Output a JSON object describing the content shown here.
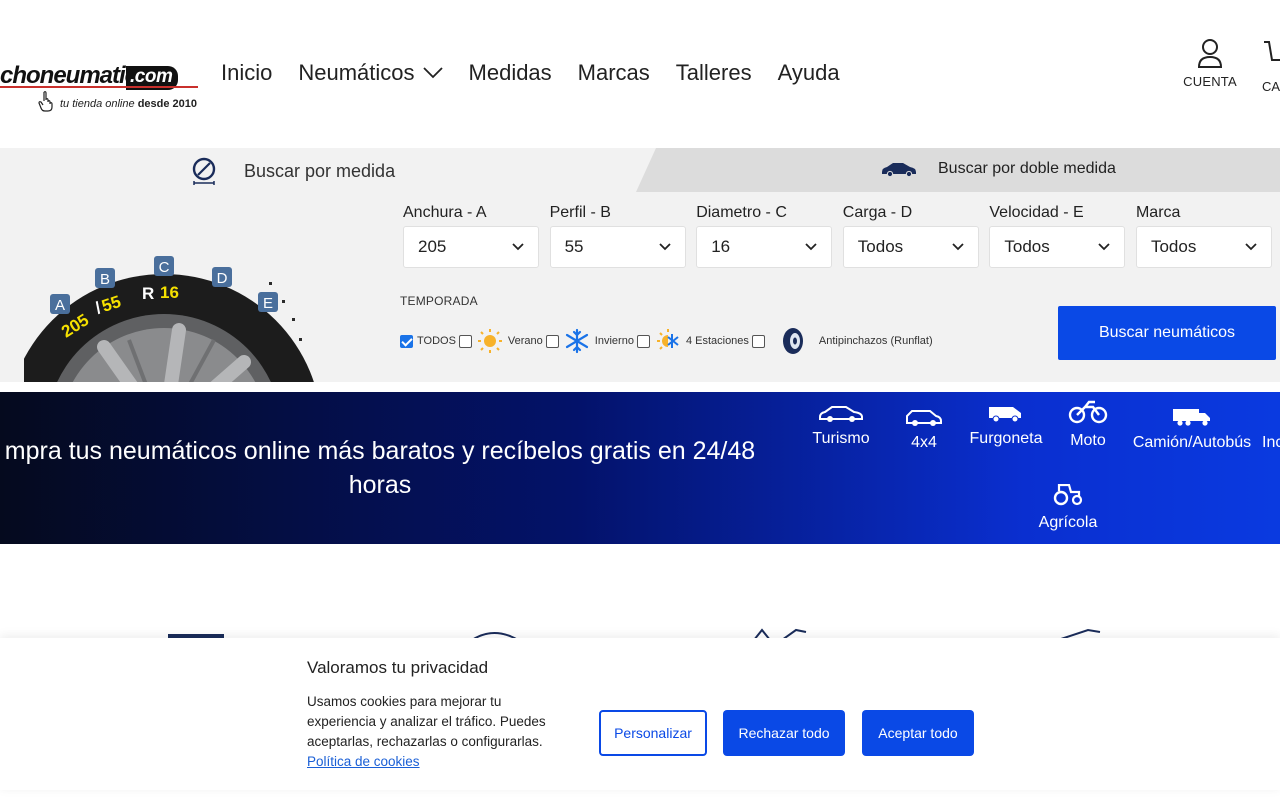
{
  "header": {
    "logo_text": "choneumatico",
    "logo_dotcom": ".com",
    "logo_tagline": "tu tienda online",
    "logo_tagline_bold": "desde 2010",
    "nav": [
      {
        "label": "Inicio"
      },
      {
        "label": "Neumáticos",
        "has_dropdown": true
      },
      {
        "label": "Medidas"
      },
      {
        "label": "Marcas"
      },
      {
        "label": "Talleres"
      },
      {
        "label": "Ayuda"
      }
    ],
    "account_label": "CUENTA",
    "cart_label": "CA"
  },
  "search": {
    "tab_medida": "Buscar por medida",
    "tab_doble": "Buscar por doble medida",
    "fields": [
      {
        "label": "Anchura - A",
        "value": "205"
      },
      {
        "label": "Perfil - B",
        "value": "55"
      },
      {
        "label": "Diametro - C",
        "value": "16"
      },
      {
        "label": "Carga - D",
        "value": "Todos"
      },
      {
        "label": "Velocidad - E",
        "value": "Todos"
      },
      {
        "label": "Marca",
        "value": "Todos"
      }
    ],
    "temporada_label": "TEMPORADA",
    "seasons": [
      {
        "label": "TODOS",
        "checked": true
      },
      {
        "label": "Verano",
        "checked": false,
        "icon": "sun-icon"
      },
      {
        "label": "Invierno",
        "checked": false,
        "icon": "snowflake-icon"
      },
      {
        "label": "4 Estaciones",
        "checked": false,
        "icon": "sun-snow-icon"
      },
      {
        "label": "Antipinchazos (Runflat)",
        "checked": false,
        "icon": "runflat-tire-icon"
      }
    ],
    "button_label": "Buscar neumáticos",
    "tire_diagram": {
      "markers": [
        "A",
        "B",
        "C",
        "D",
        "E"
      ],
      "width": "205",
      "sep": "/",
      "profile": "55",
      "r": "R",
      "diameter": "16"
    }
  },
  "banner": {
    "headline": "mpra tus neumáticos online más baratos y recíbelos gratis en 24/48 horas",
    "categories": [
      {
        "label": "Turismo",
        "icon": "car-icon"
      },
      {
        "label": "4x4",
        "icon": "suv-icon"
      },
      {
        "label": "Furgoneta",
        "icon": "van-icon"
      },
      {
        "label": "Moto",
        "icon": "motorcycle-icon"
      },
      {
        "label": "Camión/Autobús",
        "icon": "truck-icon"
      },
      {
        "label": "Inc",
        "icon": "industrial-icon"
      },
      {
        "label": "Agrícola",
        "icon": "tractor-icon"
      }
    ]
  },
  "cookie": {
    "title": "Valoramos tu privacidad",
    "body": "Usamos cookies para mejorar tu experiencia y analizar el tráfico. Puedes aceptarlas, rechazarlas o configurarlas.",
    "link": "Política de cookies",
    "btn_customize": "Personalizar",
    "btn_reject": "Rechazar todo",
    "btn_accept": "Aceptar todo"
  },
  "colors": {
    "primary": "#0a49e6",
    "marker_bg": "#4a6f9c",
    "tire_text": "#f5e000"
  }
}
